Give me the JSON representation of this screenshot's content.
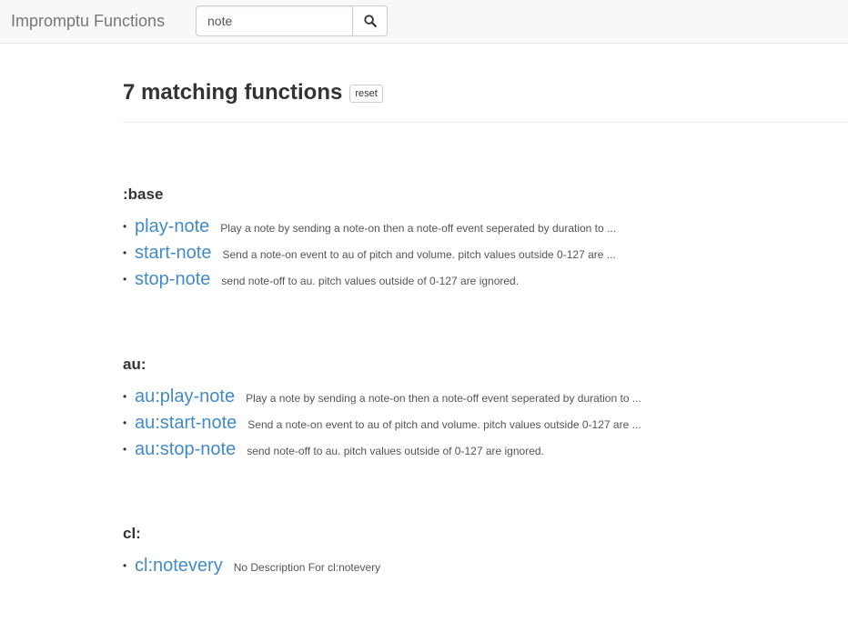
{
  "app": {
    "title": "Impromptu Functions"
  },
  "search": {
    "value": "note",
    "button_icon": "search-icon"
  },
  "results": {
    "heading": "7 matching functions",
    "reset_label": "reset"
  },
  "groups": [
    {
      "title": ":base",
      "items": [
        {
          "name": "play-note",
          "description": "Play a note by sending a note-on then a note-off event seperated by duration to ..."
        },
        {
          "name": "start-note",
          "description": "Send a note-on event to au of pitch and volume. pitch values outside 0-127 are ..."
        },
        {
          "name": "stop-note",
          "description": "send note-off to au. pitch values outside of 0-127 are ignored."
        }
      ]
    },
    {
      "title": "au:",
      "items": [
        {
          "name": "au:play-note",
          "description": "Play a note by sending a note-on then a note-off event seperated by duration to ..."
        },
        {
          "name": "au:start-note",
          "description": "Send a note-on event to au of pitch and volume. pitch values outside 0-127 are ..."
        },
        {
          "name": "au:stop-note",
          "description": "send note-off to au. pitch values outside of 0-127 are ignored."
        }
      ]
    },
    {
      "title": "cl:",
      "items": [
        {
          "name": "cl:notevery",
          "description": "No Description For cl:notevery"
        }
      ]
    }
  ],
  "colors": {
    "link": "#428bca",
    "navbar_bg": "#f8f8f8",
    "brand_text": "#777777"
  }
}
